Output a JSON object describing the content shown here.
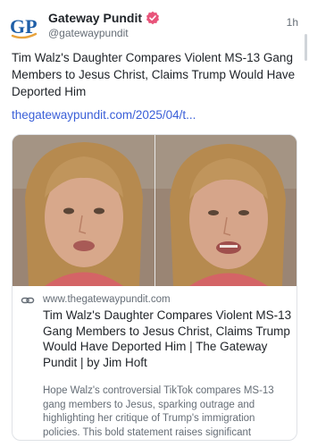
{
  "post": {
    "author_name": "Gateway Pundit",
    "author_initials": "GP",
    "handle": "@gatewaypundit",
    "timestamp": "1h",
    "text": "Tim Walz's Daughter Compares Violent MS-13 Gang Members to Jesus Christ, Claims Trump Would Have Deported Him",
    "link_text": "thegatewaypundit.com/2025/04/t..."
  },
  "card": {
    "domain": "www.thegatewaypundit.com",
    "title": "Tim Walz's Daughter Compares Violent MS-13 Gang Members to Jesus Christ, Claims Trump Would Have Deported Him | The Gateway Pundit | by Jim Hoft",
    "description": "Hope Walz's controversial TikTok compares MS-13 gang members to Jesus, sparking outrage and highlighting her critique of Trump's immigration policies. This bold statement raises significant questions about due process and political rhetoric."
  },
  "icons": {
    "avatar": "gp-logo",
    "verified": "verified-badge-icon",
    "link": "link-chain-icon"
  },
  "colors": {
    "link": "#3a5fd8",
    "verified_badge": "#e8547a",
    "logo_blue": "#1f5fa8",
    "logo_gold": "#e8a33d",
    "muted_text": "#656d76"
  }
}
